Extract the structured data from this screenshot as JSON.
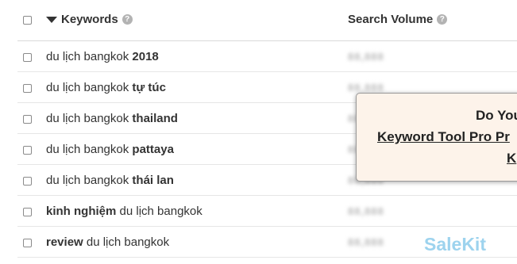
{
  "header": {
    "keywords_label": "Keywords",
    "search_volume_label": "Search Volume"
  },
  "rows": [
    {
      "plain": "du lịch bangkok ",
      "bold": "2018",
      "bold_first": false,
      "volume": "88,888"
    },
    {
      "plain": "du lịch bangkok ",
      "bold": "tự túc",
      "bold_first": false,
      "volume": "88,888"
    },
    {
      "plain": "du lịch bangkok ",
      "bold": "thailand",
      "bold_first": false,
      "volume": "88,888"
    },
    {
      "plain": "du lịch bangkok ",
      "bold": "pattaya",
      "bold_first": false,
      "volume": "88,888"
    },
    {
      "plain": "du lịch bangkok ",
      "bold": "thái lan",
      "bold_first": false,
      "volume": "88,888"
    },
    {
      "plain": " du lịch bangkok",
      "bold": "kinh nghiệm",
      "bold_first": true,
      "volume": "88,888"
    },
    {
      "plain": " du lịch bangkok",
      "bold": "review",
      "bold_first": true,
      "volume": "88,888"
    }
  ],
  "popup": {
    "line1": "Do You",
    "line2": "Keyword Tool Pro Pr",
    "line3": "K"
  },
  "watermark": "SaleKit",
  "icons": {
    "sort": "caret-down-icon",
    "help": "question-circle-icon"
  }
}
